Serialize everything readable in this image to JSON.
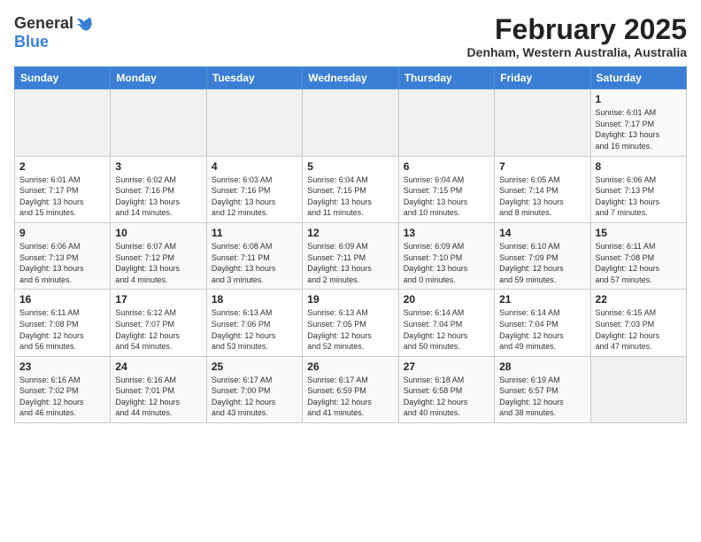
{
  "header": {
    "logo_general": "General",
    "logo_blue": "Blue",
    "month_year": "February 2025",
    "location": "Denham, Western Australia, Australia"
  },
  "weekdays": [
    "Sunday",
    "Monday",
    "Tuesday",
    "Wednesday",
    "Thursday",
    "Friday",
    "Saturday"
  ],
  "weeks": [
    [
      {
        "day": "",
        "info": ""
      },
      {
        "day": "",
        "info": ""
      },
      {
        "day": "",
        "info": ""
      },
      {
        "day": "",
        "info": ""
      },
      {
        "day": "",
        "info": ""
      },
      {
        "day": "",
        "info": ""
      },
      {
        "day": "1",
        "info": "Sunrise: 6:01 AM\nSunset: 7:17 PM\nDaylight: 13 hours\nand 16 minutes."
      }
    ],
    [
      {
        "day": "2",
        "info": "Sunrise: 6:01 AM\nSunset: 7:17 PM\nDaylight: 13 hours\nand 15 minutes."
      },
      {
        "day": "3",
        "info": "Sunrise: 6:02 AM\nSunset: 7:16 PM\nDaylight: 13 hours\nand 14 minutes."
      },
      {
        "day": "4",
        "info": "Sunrise: 6:03 AM\nSunset: 7:16 PM\nDaylight: 13 hours\nand 12 minutes."
      },
      {
        "day": "5",
        "info": "Sunrise: 6:04 AM\nSunset: 7:15 PM\nDaylight: 13 hours\nand 11 minutes."
      },
      {
        "day": "6",
        "info": "Sunrise: 6:04 AM\nSunset: 7:15 PM\nDaylight: 13 hours\nand 10 minutes."
      },
      {
        "day": "7",
        "info": "Sunrise: 6:05 AM\nSunset: 7:14 PM\nDaylight: 13 hours\nand 8 minutes."
      },
      {
        "day": "8",
        "info": "Sunrise: 6:06 AM\nSunset: 7:13 PM\nDaylight: 13 hours\nand 7 minutes."
      }
    ],
    [
      {
        "day": "9",
        "info": "Sunrise: 6:06 AM\nSunset: 7:13 PM\nDaylight: 13 hours\nand 6 minutes."
      },
      {
        "day": "10",
        "info": "Sunrise: 6:07 AM\nSunset: 7:12 PM\nDaylight: 13 hours\nand 4 minutes."
      },
      {
        "day": "11",
        "info": "Sunrise: 6:08 AM\nSunset: 7:11 PM\nDaylight: 13 hours\nand 3 minutes."
      },
      {
        "day": "12",
        "info": "Sunrise: 6:09 AM\nSunset: 7:11 PM\nDaylight: 13 hours\nand 2 minutes."
      },
      {
        "day": "13",
        "info": "Sunrise: 6:09 AM\nSunset: 7:10 PM\nDaylight: 13 hours\nand 0 minutes."
      },
      {
        "day": "14",
        "info": "Sunrise: 6:10 AM\nSunset: 7:09 PM\nDaylight: 12 hours\nand 59 minutes."
      },
      {
        "day": "15",
        "info": "Sunrise: 6:11 AM\nSunset: 7:08 PM\nDaylight: 12 hours\nand 57 minutes."
      }
    ],
    [
      {
        "day": "16",
        "info": "Sunrise: 6:11 AM\nSunset: 7:08 PM\nDaylight: 12 hours\nand 56 minutes."
      },
      {
        "day": "17",
        "info": "Sunrise: 6:12 AM\nSunset: 7:07 PM\nDaylight: 12 hours\nand 54 minutes."
      },
      {
        "day": "18",
        "info": "Sunrise: 6:13 AM\nSunset: 7:06 PM\nDaylight: 12 hours\nand 53 minutes."
      },
      {
        "day": "19",
        "info": "Sunrise: 6:13 AM\nSunset: 7:05 PM\nDaylight: 12 hours\nand 52 minutes."
      },
      {
        "day": "20",
        "info": "Sunrise: 6:14 AM\nSunset: 7:04 PM\nDaylight: 12 hours\nand 50 minutes."
      },
      {
        "day": "21",
        "info": "Sunrise: 6:14 AM\nSunset: 7:04 PM\nDaylight: 12 hours\nand 49 minutes."
      },
      {
        "day": "22",
        "info": "Sunrise: 6:15 AM\nSunset: 7:03 PM\nDaylight: 12 hours\nand 47 minutes."
      }
    ],
    [
      {
        "day": "23",
        "info": "Sunrise: 6:16 AM\nSunset: 7:02 PM\nDaylight: 12 hours\nand 46 minutes."
      },
      {
        "day": "24",
        "info": "Sunrise: 6:16 AM\nSunset: 7:01 PM\nDaylight: 12 hours\nand 44 minutes."
      },
      {
        "day": "25",
        "info": "Sunrise: 6:17 AM\nSunset: 7:00 PM\nDaylight: 12 hours\nand 43 minutes."
      },
      {
        "day": "26",
        "info": "Sunrise: 6:17 AM\nSunset: 6:59 PM\nDaylight: 12 hours\nand 41 minutes."
      },
      {
        "day": "27",
        "info": "Sunrise: 6:18 AM\nSunset: 6:58 PM\nDaylight: 12 hours\nand 40 minutes."
      },
      {
        "day": "28",
        "info": "Sunrise: 6:19 AM\nSunset: 6:57 PM\nDaylight: 12 hours\nand 38 minutes."
      },
      {
        "day": "",
        "info": ""
      }
    ]
  ]
}
